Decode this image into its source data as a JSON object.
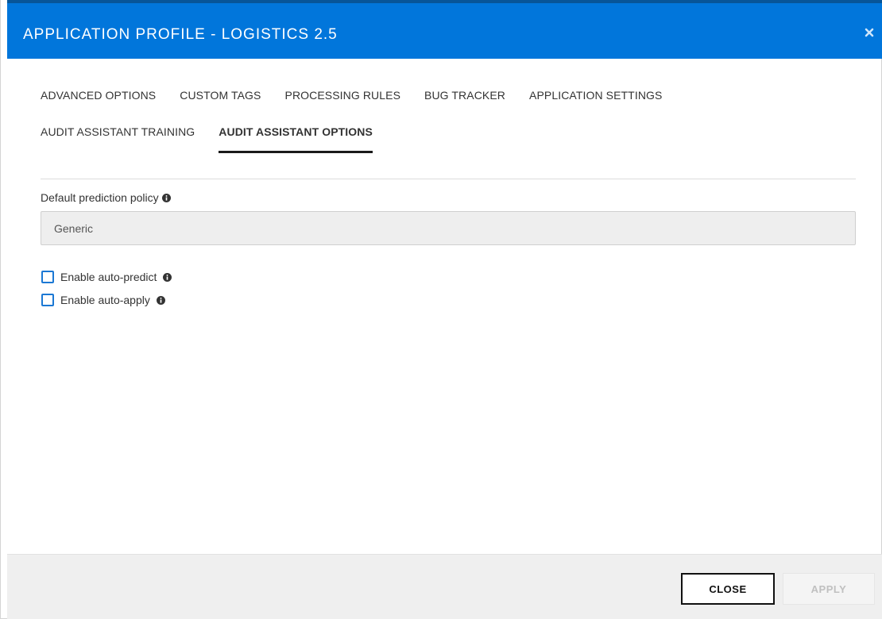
{
  "dialog": {
    "title": "APPLICATION PROFILE - LOGISTICS 2.5",
    "close_icon": "close-icon",
    "colors": {
      "header": "#0176db",
      "checkbox": "#1b78d4"
    }
  },
  "tabs": [
    {
      "label": "ADVANCED OPTIONS",
      "active": false
    },
    {
      "label": "CUSTOM TAGS",
      "active": false
    },
    {
      "label": "PROCESSING RULES",
      "active": false
    },
    {
      "label": "BUG TRACKER",
      "active": false
    },
    {
      "label": "APPLICATION SETTINGS",
      "active": false
    },
    {
      "label": "AUDIT ASSISTANT TRAINING",
      "active": false
    },
    {
      "label": "AUDIT ASSISTANT OPTIONS",
      "active": true
    }
  ],
  "form": {
    "prediction_policy_label": "Default prediction policy",
    "prediction_policy_value": "Generic",
    "auto_predict_label": "Enable auto-predict",
    "auto_predict_checked": false,
    "auto_apply_label": "Enable auto-apply",
    "auto_apply_checked": false,
    "info_icon": "info-icon"
  },
  "footer": {
    "close_label": "CLOSE",
    "apply_label": "APPLY",
    "apply_enabled": false
  }
}
